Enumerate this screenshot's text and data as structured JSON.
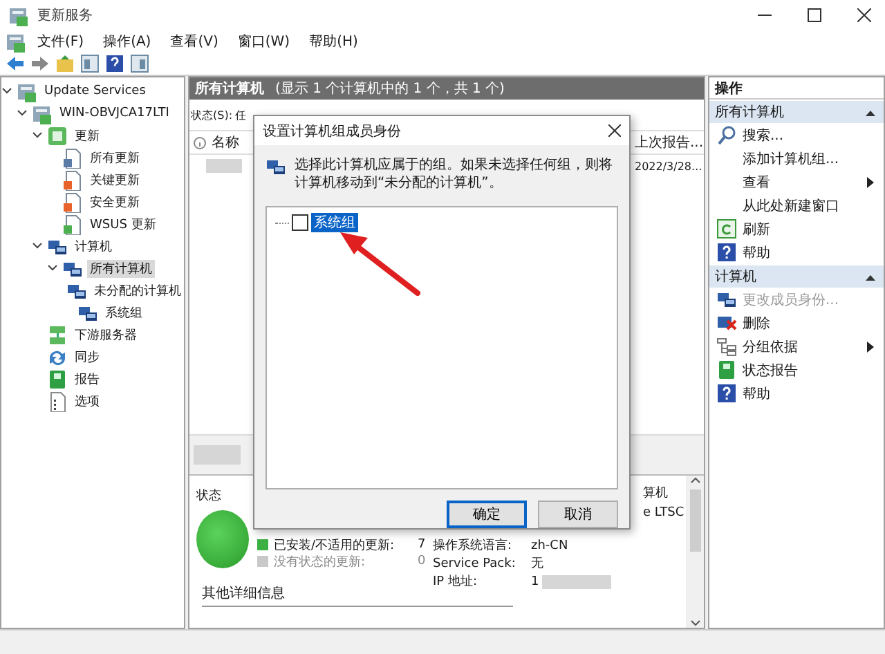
{
  "window": {
    "title": "更新服务"
  },
  "menu": [
    "文件(F)",
    "操作(A)",
    "查看(V)",
    "窗口(W)",
    "帮助(H)"
  ],
  "tree": [
    {
      "label": "Update Services",
      "kind": "server",
      "expanded": true,
      "selected": false,
      "children": [
        {
          "label": "WIN-OBVJCA17LTI",
          "kind": "server",
          "expanded": true,
          "selected": false,
          "children": [
            {
              "label": "更新",
              "kind": "updates",
              "expanded": true,
              "selected": false,
              "children": [
                {
                  "label": "所有更新",
                  "kind": "doc",
                  "selected": false
                },
                {
                  "label": "关键更新",
                  "kind": "critical",
                  "selected": false
                },
                {
                  "label": "安全更新",
                  "kind": "critical",
                  "selected": false
                },
                {
                  "label": "WSUS 更新",
                  "kind": "wsus",
                  "selected": false
                }
              ]
            },
            {
              "label": "计算机",
              "kind": "computers",
              "expanded": true,
              "selected": false,
              "children": [
                {
                  "label": "所有计算机",
                  "kind": "computers",
                  "expanded": true,
                  "selected": true,
                  "children": [
                    {
                      "label": "未分配的计算机",
                      "kind": "computers",
                      "selected": false
                    },
                    {
                      "label": "系统组",
                      "kind": "computers",
                      "selected": false
                    }
                  ]
                }
              ]
            },
            {
              "label": "下游服务器",
              "kind": "downstream",
              "selected": false
            },
            {
              "label": "同步",
              "kind": "sync",
              "selected": false
            },
            {
              "label": "报告",
              "kind": "report",
              "selected": false
            },
            {
              "label": "选项",
              "kind": "options",
              "selected": false
            }
          ]
        }
      ]
    }
  ],
  "center": {
    "header": "所有计算机",
    "header_note": "(显示 1 个计算机中的 1 个，共 1 个)",
    "filter_label": "状态(S):",
    "filter_value": "任",
    "columns": [
      "名称",
      "上次报告..."
    ],
    "rows": [
      {
        "last_report": "2022/3/28..."
      }
    ],
    "details": {
      "status_label": "状态",
      "legend": [
        {
          "label": "已安装/不适用的更新:",
          "count": "7",
          "color": "#3cb043"
        },
        {
          "label": "没有状态的更新:",
          "count": "0",
          "color": "#c8c8c8"
        }
      ],
      "partial": [
        "算机",
        "e LTSC"
      ],
      "info": [
        {
          "label": "操作系统语言:",
          "value": "zh-CN"
        },
        {
          "label": "Service Pack:",
          "value": "无"
        },
        {
          "label": "IP 地址:",
          "value": "1"
        }
      ],
      "more": "其他详细信息"
    }
  },
  "actions": {
    "title": "操作",
    "sections": [
      {
        "title": "所有计算机",
        "items": [
          {
            "label": "搜索...",
            "kind": "search",
            "disabled": false,
            "submenu": false
          },
          {
            "label": "添加计算机组...",
            "kind": "plain",
            "disabled": false,
            "submenu": false
          },
          {
            "label": "查看",
            "kind": "plain",
            "disabled": false,
            "submenu": true
          },
          {
            "label": "从此处新建窗口",
            "kind": "plain",
            "disabled": false,
            "submenu": false
          },
          {
            "label": "刷新",
            "kind": "refresh",
            "disabled": false,
            "submenu": false
          },
          {
            "label": "帮助",
            "kind": "help",
            "disabled": false,
            "submenu": false
          }
        ]
      },
      {
        "title": "计算机",
        "items": [
          {
            "label": "更改成员身份...",
            "kind": "computers",
            "disabled": true,
            "submenu": false
          },
          {
            "label": "删除",
            "kind": "delete",
            "disabled": false,
            "submenu": false
          },
          {
            "label": "分组依据",
            "kind": "group",
            "disabled": false,
            "submenu": true
          },
          {
            "label": "状态报告",
            "kind": "report",
            "disabled": false,
            "submenu": false
          },
          {
            "label": "帮助",
            "kind": "help",
            "disabled": false,
            "submenu": false
          }
        ]
      }
    ]
  },
  "dialog": {
    "title": "设置计算机组成员身份",
    "message": "选择此计算机应属于的组。如果未选择任何组，则将计算机移动到“未分配的计算机”。",
    "groups": [
      {
        "label": "系统组",
        "checked": false,
        "selected": true
      }
    ],
    "buttons": [
      {
        "label": "确定",
        "default": true
      },
      {
        "label": "取消",
        "default": false
      }
    ]
  }
}
